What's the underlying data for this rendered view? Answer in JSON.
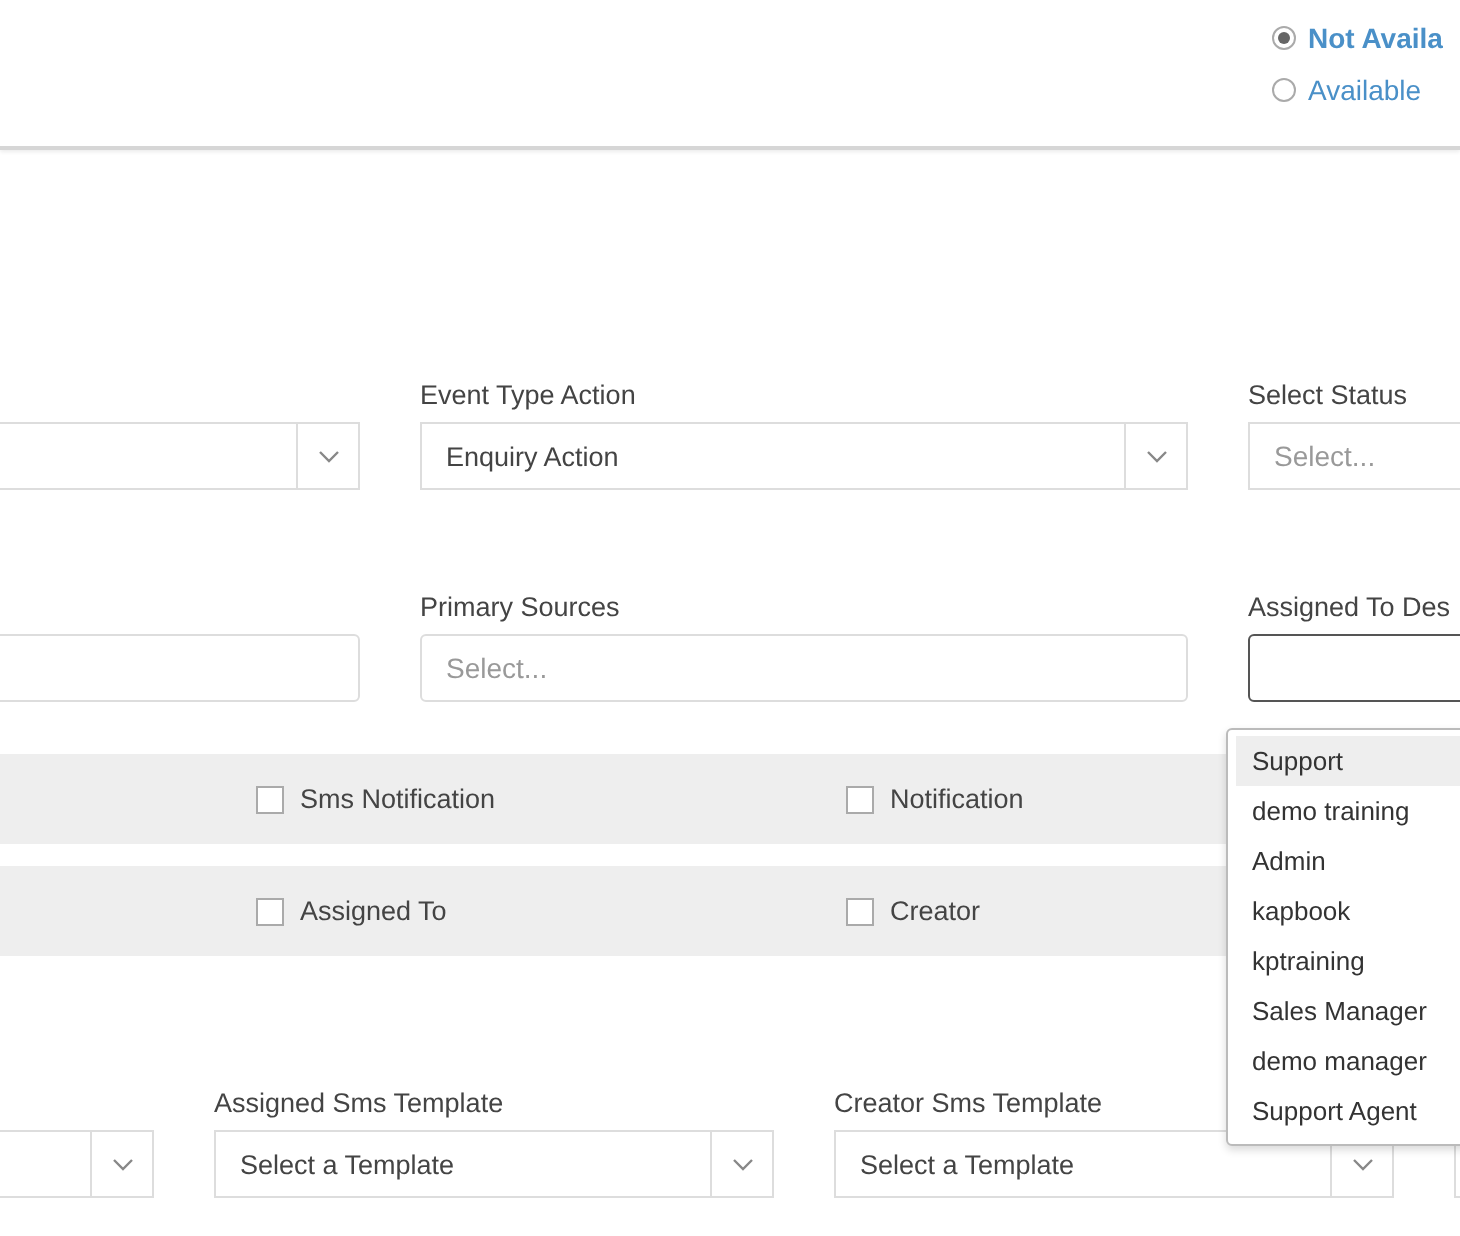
{
  "availability": [
    {
      "label": "Not Availa",
      "selected": true
    },
    {
      "label": "Available",
      "selected": false
    }
  ],
  "form_row_1": [
    {
      "kind": "select"
    },
    {
      "kind": "select",
      "label": "Event Type Action",
      "value": "Enquiry Action"
    },
    {
      "kind": "select",
      "label": "Select Status",
      "placeholder": "Select..."
    }
  ],
  "form_row_2": [
    {
      "kind": "input",
      "focused": false
    },
    {
      "kind": "input",
      "label": "Primary Sources",
      "placeholder": "Select...",
      "focused": false
    },
    {
      "kind": "input",
      "label": "Assigned To Des",
      "focused": true
    }
  ],
  "notification_rows": [
    [
      {
        "label": "Sms Notification",
        "checked": false
      },
      {
        "label": "Notification",
        "checked": false
      }
    ],
    [
      {
        "label": "Assigned To",
        "checked": false
      },
      {
        "label": "Creator",
        "checked": false
      }
    ]
  ],
  "template_row": [
    {
      "kind": "select"
    },
    {
      "kind": "select",
      "label": "Assigned Sms Template",
      "value": "Select a Template"
    },
    {
      "kind": "select",
      "label": "Creator Sms Template",
      "value": "Select a Template"
    },
    {
      "kind": "select"
    }
  ],
  "dropdown_options": [
    {
      "label": "Support",
      "selected": true
    },
    {
      "label": "demo training",
      "selected": false
    },
    {
      "label": "Admin",
      "selected": false
    },
    {
      "label": "kapbook",
      "selected": false
    },
    {
      "label": "kptraining",
      "selected": false
    },
    {
      "label": "Sales Manager",
      "selected": false
    },
    {
      "label": "demo manager",
      "selected": false
    },
    {
      "label": "Support Agent",
      "selected": false
    }
  ]
}
